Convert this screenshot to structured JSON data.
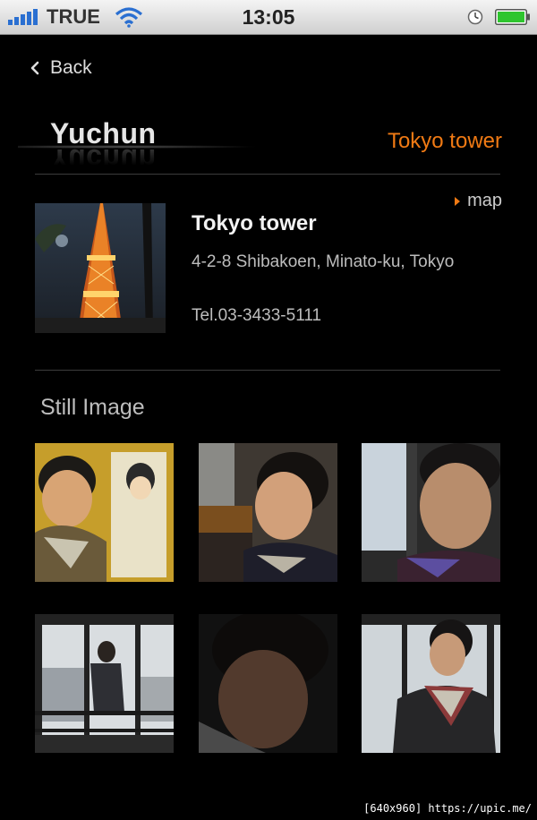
{
  "status_bar": {
    "carrier": "TRUE",
    "time": "13:05"
  },
  "nav": {
    "back_label": "Back"
  },
  "header": {
    "artist": "Yuchun",
    "place_title": "Tokyo tower"
  },
  "place": {
    "map_label": "map",
    "name": "Tokyo tower",
    "address": "4-2-8 Shibakoen, Minato-ku, Tokyo",
    "tel": "Tel.03-3433-5111"
  },
  "gallery": {
    "title": "Still Image"
  },
  "footer": {
    "watermark": "[640x960] https://upic.me/"
  },
  "colors": {
    "accent": "#f07a14",
    "background": "#000000"
  }
}
